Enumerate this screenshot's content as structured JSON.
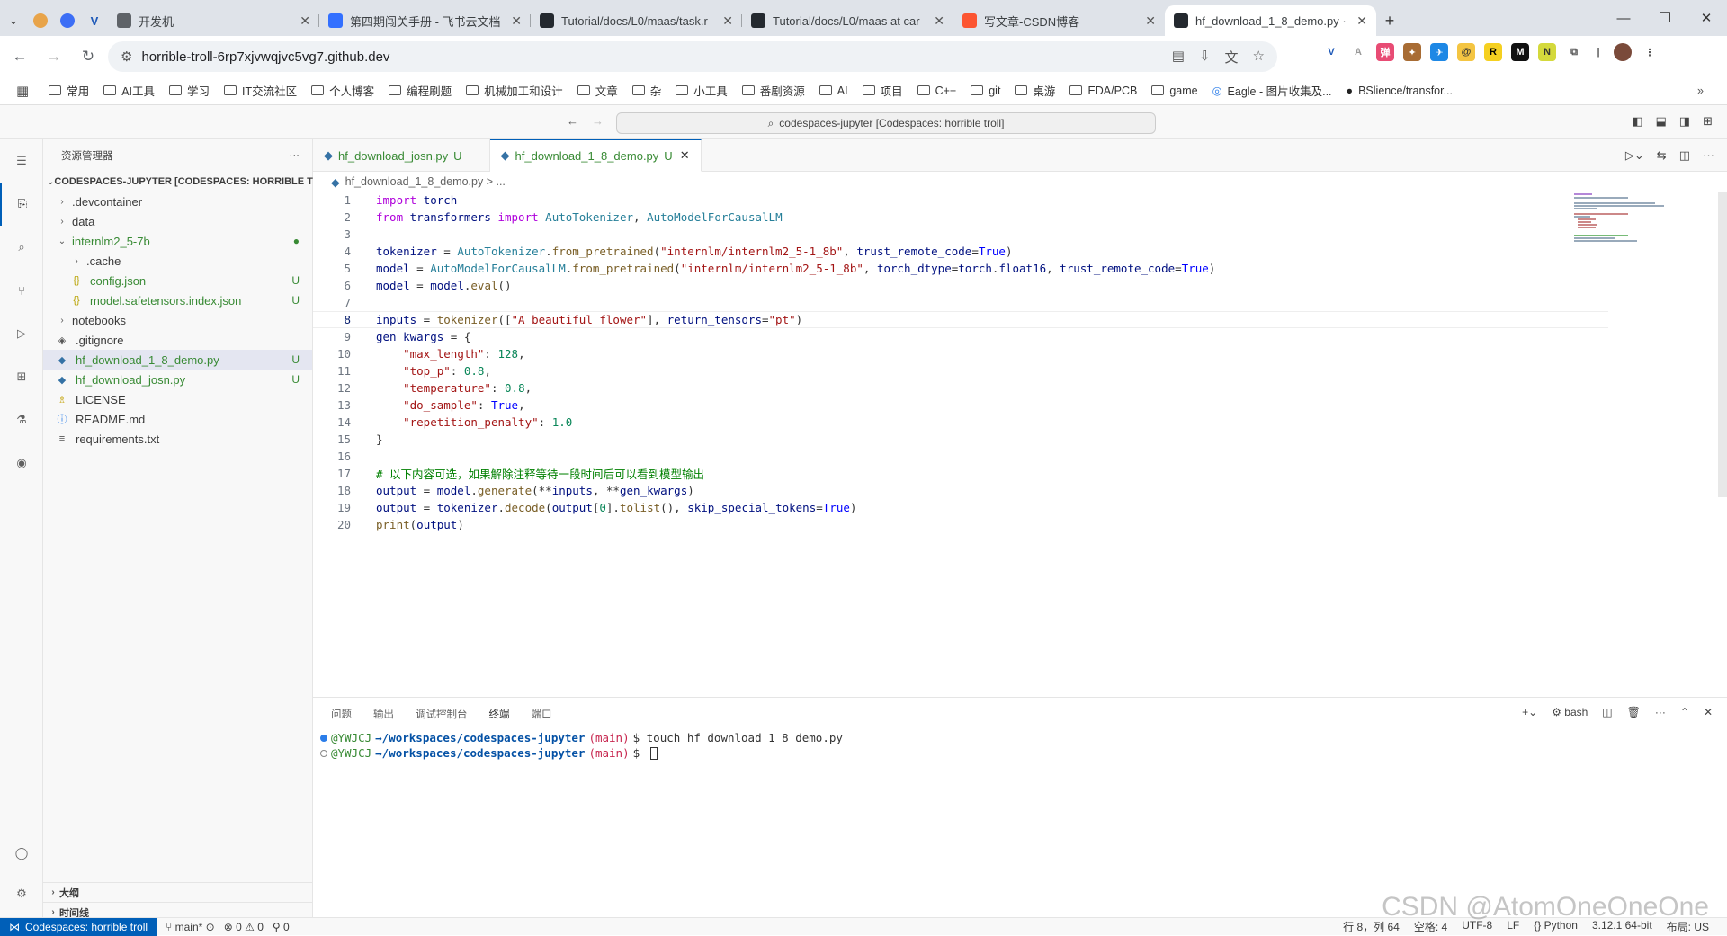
{
  "browser": {
    "tabs": [
      {
        "label": "开发机",
        "icon": "dev-icon",
        "color": "#5f6368"
      },
      {
        "label": "第四期闯关手册 - 飞书云文档",
        "icon": "doc-icon",
        "color": "#3370ff"
      },
      {
        "label": "Tutorial/docs/L0/maas/task.r",
        "icon": "github-icon",
        "color": "#24292f"
      },
      {
        "label": "Tutorial/docs/L0/maas at car",
        "icon": "github-icon",
        "color": "#24292f"
      },
      {
        "label": "写文章-CSDN博客",
        "icon": "csdn-icon",
        "color": "#fc5531"
      },
      {
        "label": "hf_download_1_8_demo.py ·",
        "icon": "github-icon",
        "color": "#24292f"
      }
    ],
    "url": "horrible-troll-6rp7xjvwqjvc5vg7.github.dev",
    "bookmarks": [
      "常用",
      "AI工具",
      "学习",
      "IT交流社区",
      "个人博客",
      "编程刷题",
      "机械加工和设计",
      "文章",
      "杂",
      "小工具",
      "番剧资源",
      "AI",
      "项目",
      "C++",
      "git",
      "桌游",
      "EDA/PCB",
      "game",
      "Eagle - 图片收集及...",
      "BSlience/transfor..."
    ]
  },
  "vscode": {
    "command_center": "codespaces-jupyter [Codespaces: horrible troll]",
    "explorer": {
      "title": "资源管理器",
      "root": "CODESPACES-JUPYTER [CODESPACES: HORRIBLE TR...",
      "items": [
        {
          "label": ".devcontainer",
          "type": "folder",
          "status": ""
        },
        {
          "label": "data",
          "type": "folder",
          "status": ""
        },
        {
          "label": "internlm2_5-7b",
          "type": "folder-open",
          "status": "●"
        },
        {
          "label": ".cache",
          "type": "folder",
          "status": ""
        },
        {
          "label": "config.json",
          "type": "json",
          "status": "U"
        },
        {
          "label": "model.safetensors.index.json",
          "type": "json",
          "status": "U"
        },
        {
          "label": "notebooks",
          "type": "folder",
          "status": ""
        },
        {
          "label": ".gitignore",
          "type": "git",
          "status": ""
        },
        {
          "label": "hf_download_1_8_demo.py",
          "type": "python",
          "status": "U"
        },
        {
          "label": "hf_download_josn.py",
          "type": "python",
          "status": "U"
        },
        {
          "label": "LICENSE",
          "type": "license",
          "status": ""
        },
        {
          "label": "README.md",
          "type": "info",
          "status": ""
        },
        {
          "label": "requirements.txt",
          "type": "text",
          "status": ""
        }
      ],
      "outline": "大纲",
      "timeline": "时间线"
    },
    "editor_tabs": [
      {
        "label": "hf_download_josn.py",
        "status": "U"
      },
      {
        "label": "hf_download_1_8_demo.py",
        "status": "U"
      }
    ],
    "breadcrumb": "hf_download_1_8_demo.py > ...",
    "code_lines": [
      "import torch",
      "from transformers import AutoTokenizer, AutoModelForCausalLM",
      "",
      "tokenizer = AutoTokenizer.from_pretrained(\"internlm/internlm2_5-1_8b\", trust_remote_code=True)",
      "model = AutoModelForCausalLM.from_pretrained(\"internlm/internlm2_5-1_8b\", torch_dtype=torch.float16, trust_remote_code=True)",
      "model = model.eval()",
      "",
      "inputs = tokenizer([\"A beautiful flower\"], return_tensors=\"pt\")",
      "gen_kwargs = {",
      "    \"max_length\": 128,",
      "    \"top_p\": 0.8,",
      "    \"temperature\": 0.8,",
      "    \"do_sample\": True,",
      "    \"repetition_penalty\": 1.0",
      "}",
      "",
      "# 以下内容可选，如果解除注释等待一段时间后可以看到模型输出",
      "output = model.generate(**inputs, **gen_kwargs)",
      "output = tokenizer.decode(output[0].tolist(), skip_special_tokens=True)",
      "print(output)"
    ],
    "panel_tabs": [
      "问题",
      "输出",
      "调试控制台",
      "终端",
      "端口"
    ],
    "terminal_shell": "bash",
    "terminal_lines": [
      {
        "user": "@YWJCJ",
        "path": "→/workspaces/codespaces-jupyter",
        "branch": "(main)",
        "cmd": "$ touch hf_download_1_8_demo.py"
      },
      {
        "user": "@YWJCJ",
        "path": "→/workspaces/codespaces-jupyter",
        "branch": "(main)",
        "cmd": "$ "
      }
    ],
    "status": {
      "remote": "Codespaces: horrible troll",
      "branch": "main*",
      "errors": "0",
      "warnings": "0",
      "ports": "0",
      "position": "行 8，列 64",
      "spaces": "空格: 4",
      "encoding": "UTF-8",
      "eol": "LF",
      "language": "Python",
      "version": "3.12.1 64-bit",
      "layout": "布局: US"
    }
  },
  "watermark": "CSDN @AtomOneOneOne"
}
